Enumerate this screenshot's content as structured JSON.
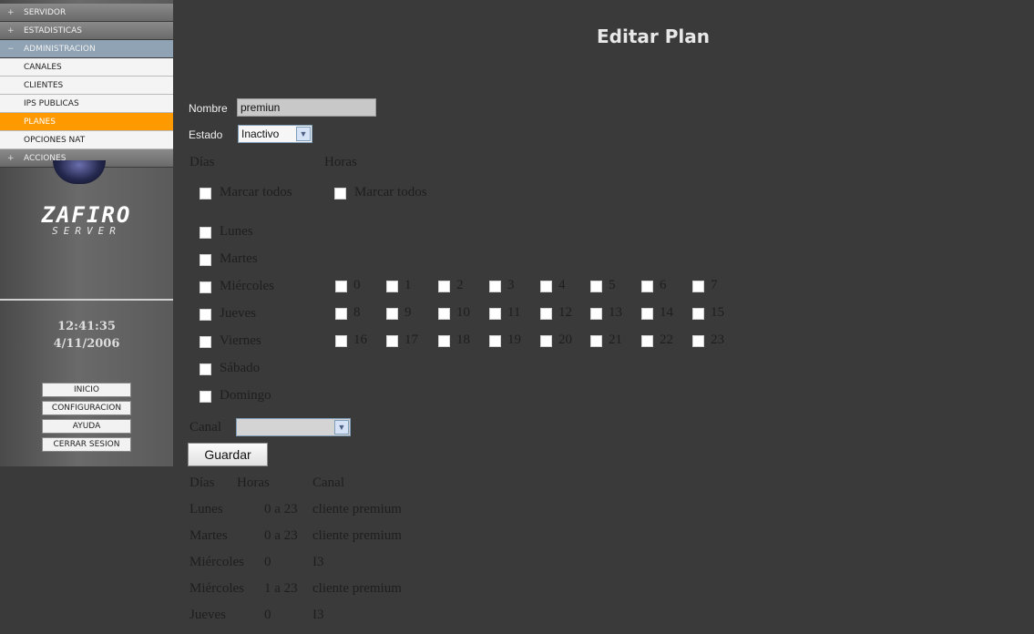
{
  "menu": {
    "items": [
      {
        "label": "SERVIDOR",
        "kind": "section",
        "mark": "+"
      },
      {
        "label": "ESTADISTICAS",
        "kind": "section",
        "mark": "+"
      },
      {
        "label": "ADMINISTRACION",
        "kind": "section",
        "mark": "−"
      },
      {
        "label": "CANALES",
        "kind": "sub"
      },
      {
        "label": "CLIENTES",
        "kind": "sub"
      },
      {
        "label": "IPS PUBLICAS",
        "kind": "sub"
      },
      {
        "label": "PLANES",
        "kind": "sub",
        "active": true
      },
      {
        "label": "OPCIONES NAT",
        "kind": "sub"
      },
      {
        "label": "ACCIONES",
        "kind": "section",
        "mark": "+"
      }
    ]
  },
  "logo": {
    "title": "ZAFIRO",
    "subtitle": "SERVER"
  },
  "clock": {
    "time": "12:41:35",
    "date": "4/11/2006"
  },
  "sidebar_buttons": [
    "INICIO",
    "CONFIGURACION",
    "AYUDA",
    "CERRAR SESION"
  ],
  "page": {
    "title": "Editar Plan"
  },
  "form": {
    "nombre_label": "Nombre",
    "nombre_value": "premiun",
    "estado_label": "Estado",
    "estado_value": "Inactivo",
    "dias_header": "Días",
    "horas_header": "Horas",
    "marcar_todos_dias": "Marcar todos",
    "marcar_todos_horas": "Marcar todos",
    "days": [
      "Lunes",
      "Martes",
      "Miércoles",
      "Jueves",
      "Viernes",
      "Sábado",
      "Domingo"
    ],
    "hours": [
      "0",
      "1",
      "2",
      "3",
      "4",
      "5",
      "6",
      "7",
      "8",
      "9",
      "10",
      "11",
      "12",
      "13",
      "14",
      "15",
      "16",
      "17",
      "18",
      "19",
      "20",
      "21",
      "22",
      "23"
    ],
    "canal_label": "Canal",
    "canal_value": "",
    "guardar_label": "Guardar"
  },
  "summary": {
    "headers": [
      "Días",
      "Horas",
      "Canal"
    ],
    "rows": [
      {
        "dia": "Lunes",
        "horas": "0 a 23",
        "canal": "cliente premium"
      },
      {
        "dia": "Martes",
        "horas": "0 a 23",
        "canal": "cliente premium"
      },
      {
        "dia": "Miércoles",
        "horas": "0",
        "canal": "I3"
      },
      {
        "dia": "Miércoles",
        "horas": "1 a 23",
        "canal": "cliente premium"
      },
      {
        "dia": "Jueves",
        "horas": "0",
        "canal": "I3"
      }
    ]
  },
  "colors": {
    "accent": "#ff9900",
    "admin_section": "#8fa3b4",
    "background": "#3a3a3a"
  }
}
